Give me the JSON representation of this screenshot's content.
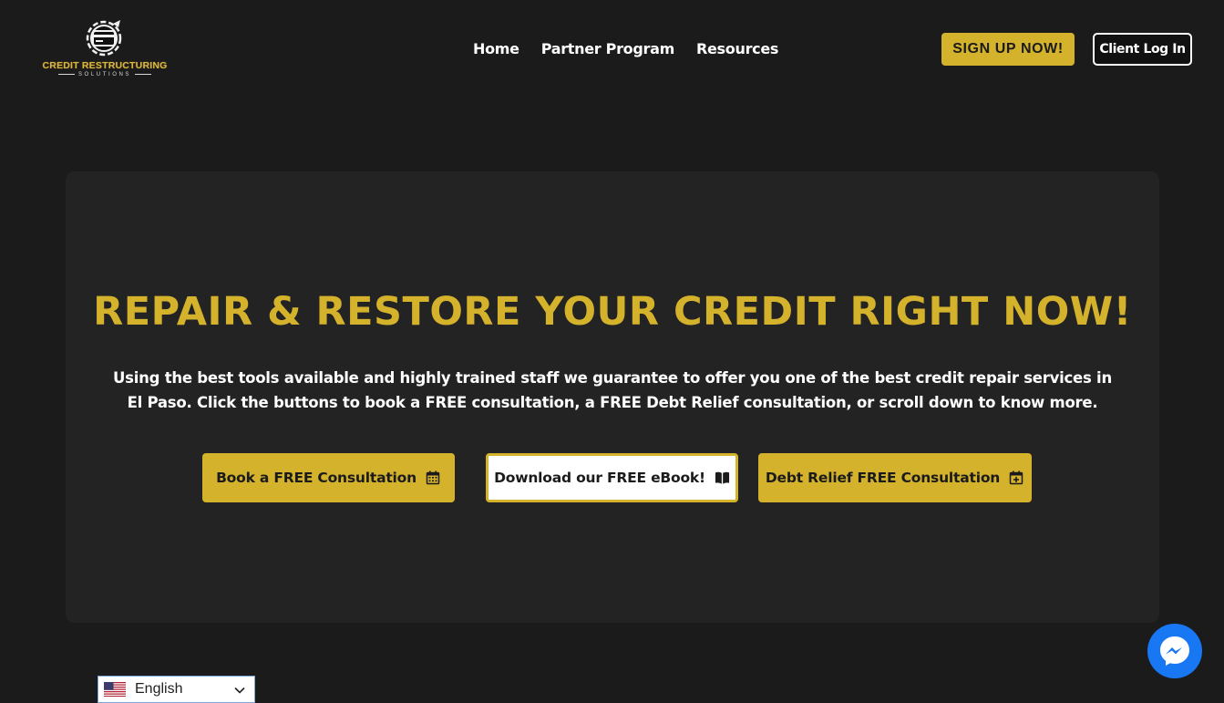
{
  "logo": {
    "name": "CREDIT RESTRUCTURING",
    "sub": "SOLUTIONS",
    "icon": "credit-card-gear-logo"
  },
  "nav": {
    "items": [
      {
        "label": "Home"
      },
      {
        "label": "Partner Program"
      },
      {
        "label": "Resources"
      }
    ]
  },
  "header_buttons": {
    "signup": "SIGN UP NOW!",
    "login": "Client Log In"
  },
  "hero": {
    "title": "REPAIR & RESTORE YOUR CREDIT RIGHT NOW!",
    "text": "Using the best tools available and highly trained staff we guarantee to offer you one of the best credit repair services in El Paso. Click the buttons to book a FREE consultation, a FREE Debt Relief consultation, or scroll down to know more.",
    "buttons": [
      {
        "label": "Book a FREE Consultation",
        "icon": "calendar-icon"
      },
      {
        "label": "Download our FREE eBook!",
        "icon": "book-open-icon"
      },
      {
        "label": "Debt Relief FREE Consultation",
        "icon": "calendar-plus-icon"
      }
    ]
  },
  "language": {
    "selected": "English",
    "icon": "us-flag-icon"
  },
  "chat": {
    "icon": "messenger-icon"
  },
  "colors": {
    "background": "#1b1b1b",
    "panel": "#232323",
    "accent": "#d4b22c",
    "text": "#ffffff",
    "messenger": "#1877f2"
  }
}
